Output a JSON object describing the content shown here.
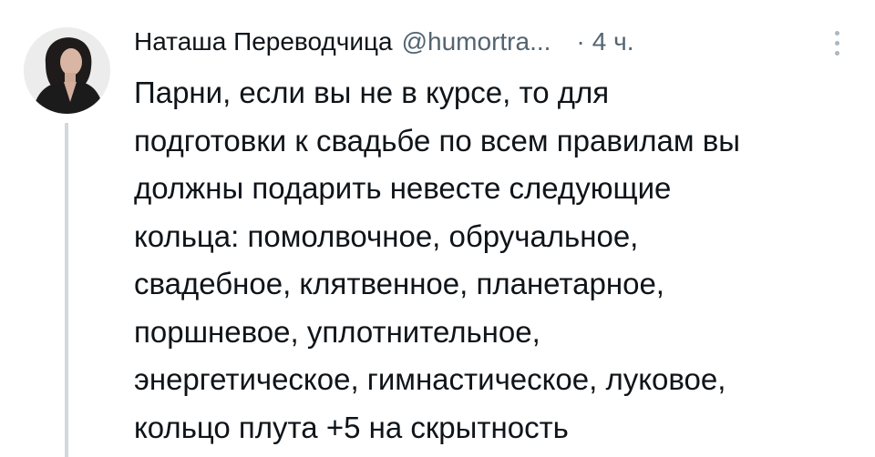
{
  "tweet": {
    "author_name": "Наташа Переводчица",
    "handle": "@humortra...",
    "separator": "·",
    "time": "4 ч.",
    "more_icon": "more-vertical-icon",
    "avatar": "avatar-photo",
    "lines": [
      "Парни, если вы не в курсе, то для",
      "подготовки к свадьбе по всем правилам вы",
      "должны подарить невесте следующие",
      "кольца: помолвочное, обручальное,",
      "свадебное, клятвенное, планетарное,",
      "поршневое, уплотнительное,",
      "энергетическое, гимнастическое, луковое,",
      "кольцо плута +5 на скрытность"
    ]
  },
  "colors": {
    "text": "#0f1419",
    "secondary": "#536471",
    "thread_line": "#cfd9de",
    "background": "#ffffff"
  }
}
